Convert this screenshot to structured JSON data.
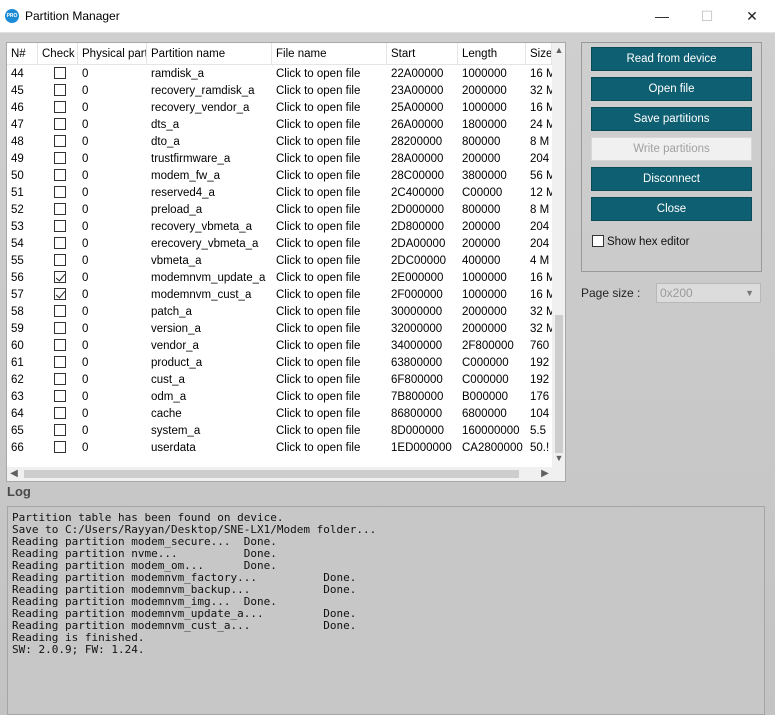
{
  "window": {
    "title": "Partition Manager",
    "app_icon_text": "PRO"
  },
  "table": {
    "columns": [
      "N#",
      "Check",
      "Physical part",
      "Partition name",
      "File name",
      "Start",
      "Length",
      "Size"
    ],
    "rows": [
      {
        "n": "44",
        "checked": false,
        "phys": "0",
        "name": "ramdisk_a",
        "file": "Click to open file",
        "start": "22A00000",
        "length": "1000000",
        "size": "16 M"
      },
      {
        "n": "45",
        "checked": false,
        "phys": "0",
        "name": "recovery_ramdisk_a",
        "file": "Click to open file",
        "start": "23A00000",
        "length": "2000000",
        "size": "32 M"
      },
      {
        "n": "46",
        "checked": false,
        "phys": "0",
        "name": "recovery_vendor_a",
        "file": "Click to open file",
        "start": "25A00000",
        "length": "1000000",
        "size": "16 M"
      },
      {
        "n": "47",
        "checked": false,
        "phys": "0",
        "name": "dts_a",
        "file": "Click to open file",
        "start": "26A00000",
        "length": "1800000",
        "size": "24 M"
      },
      {
        "n": "48",
        "checked": false,
        "phys": "0",
        "name": "dto_a",
        "file": "Click to open file",
        "start": "28200000",
        "length": "800000",
        "size": "8 M"
      },
      {
        "n": "49",
        "checked": false,
        "phys": "0",
        "name": "trustfirmware_a",
        "file": "Click to open file",
        "start": "28A00000",
        "length": "200000",
        "size": "204"
      },
      {
        "n": "50",
        "checked": false,
        "phys": "0",
        "name": "modem_fw_a",
        "file": "Click to open file",
        "start": "28C00000",
        "length": "3800000",
        "size": "56 M"
      },
      {
        "n": "51",
        "checked": false,
        "phys": "0",
        "name": "reserved4_a",
        "file": "Click to open file",
        "start": "2C400000",
        "length": "C00000",
        "size": "12 M"
      },
      {
        "n": "52",
        "checked": false,
        "phys": "0",
        "name": "preload_a",
        "file": "Click to open file",
        "start": "2D000000",
        "length": "800000",
        "size": "8 M"
      },
      {
        "n": "53",
        "checked": false,
        "phys": "0",
        "name": "recovery_vbmeta_a",
        "file": "Click to open file",
        "start": "2D800000",
        "length": "200000",
        "size": "204"
      },
      {
        "n": "54",
        "checked": false,
        "phys": "0",
        "name": "erecovery_vbmeta_a",
        "file": "Click to open file",
        "start": "2DA00000",
        "length": "200000",
        "size": "204"
      },
      {
        "n": "55",
        "checked": false,
        "phys": "0",
        "name": "vbmeta_a",
        "file": "Click to open file",
        "start": "2DC00000",
        "length": "400000",
        "size": "4 M"
      },
      {
        "n": "56",
        "checked": true,
        "phys": "0",
        "name": "modemnvm_update_a",
        "file": "Click to open file",
        "start": "2E000000",
        "length": "1000000",
        "size": "16 M"
      },
      {
        "n": "57",
        "checked": true,
        "phys": "0",
        "name": "modemnvm_cust_a",
        "file": "Click to open file",
        "start": "2F000000",
        "length": "1000000",
        "size": "16 M"
      },
      {
        "n": "58",
        "checked": false,
        "phys": "0",
        "name": "patch_a",
        "file": "Click to open file",
        "start": "30000000",
        "length": "2000000",
        "size": "32 M"
      },
      {
        "n": "59",
        "checked": false,
        "phys": "0",
        "name": "version_a",
        "file": "Click to open file",
        "start": "32000000",
        "length": "2000000",
        "size": "32 M"
      },
      {
        "n": "60",
        "checked": false,
        "phys": "0",
        "name": "vendor_a",
        "file": "Click to open file",
        "start": "34000000",
        "length": "2F800000",
        "size": "760"
      },
      {
        "n": "61",
        "checked": false,
        "phys": "0",
        "name": "product_a",
        "file": "Click to open file",
        "start": "63800000",
        "length": "C000000",
        "size": "192"
      },
      {
        "n": "62",
        "checked": false,
        "phys": "0",
        "name": "cust_a",
        "file": "Click to open file",
        "start": "6F800000",
        "length": "C000000",
        "size": "192"
      },
      {
        "n": "63",
        "checked": false,
        "phys": "0",
        "name": "odm_a",
        "file": "Click to open file",
        "start": "7B800000",
        "length": "B000000",
        "size": "176"
      },
      {
        "n": "64",
        "checked": false,
        "phys": "0",
        "name": "cache",
        "file": "Click to open file",
        "start": "86800000",
        "length": "6800000",
        "size": "104"
      },
      {
        "n": "65",
        "checked": false,
        "phys": "0",
        "name": "system_a",
        "file": "Click to open file",
        "start": "8D000000",
        "length": "160000000",
        "size": "5.5"
      },
      {
        "n": "66",
        "checked": false,
        "phys": "0",
        "name": "userdata",
        "file": "Click to open file",
        "start": "1ED000000",
        "length": "CA2800000",
        "size": "50.!"
      }
    ]
  },
  "buttons": {
    "read": "Read from device",
    "open": "Open file",
    "save": "Save partitions",
    "write": "Write partitions",
    "disconnect": "Disconnect",
    "close": "Close"
  },
  "hex_editor": {
    "label": "Show hex editor",
    "checked": false
  },
  "page_size": {
    "label": "Page size :",
    "value": "0x200"
  },
  "log": {
    "label": "Log",
    "lines": [
      "Partition table has been found on device.",
      "Save to C:/Users/Rayyan/Desktop/SNE-LX1/Modem folder...",
      "Reading partition modem_secure...  Done.",
      "Reading partition nvme...          Done.",
      "Reading partition modem_om...      Done.",
      "Reading partition modemnvm_factory...          Done.",
      "Reading partition modemnvm_backup...           Done.",
      "Reading partition modemnvm_img...  Done.",
      "Reading partition modemnvm_update_a...         Done.",
      "Reading partition modemnvm_cust_a...           Done.",
      "Reading is finished.",
      "SW: 2.0.9; FW: 1.24."
    ]
  },
  "colors": {
    "accent_button": "#0e5f72",
    "app_icon": "#1b8bd6"
  }
}
